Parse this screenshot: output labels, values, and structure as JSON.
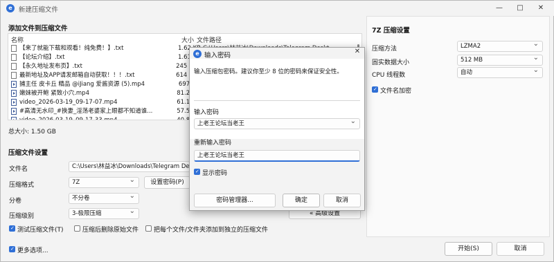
{
  "window": {
    "title": "新建压缩文件",
    "minimize": "—",
    "maximize": "□",
    "close": "✕"
  },
  "files_section": {
    "title": "添加文件到压缩文件",
    "columns": {
      "name": "名称",
      "size": "大小",
      "path": "文件路径"
    },
    "rows": [
      {
        "name": "【来了就能下载和观看！纯免费！】.txt",
        "size": "1.62 KB",
        "path": "C:\\Users\\林益冰\\Downloads\\Telegram Deskt",
        "type": "txt"
      },
      {
        "name": "【论坛介绍】.txt",
        "size": "1.61 KB",
        "path": "",
        "type": "txt"
      },
      {
        "name": "【永久地址发布页】.txt",
        "size": "245 字节",
        "path": "",
        "type": "txt"
      },
      {
        "name": "最新地址及APP请发邮箱自动获取！！！.txt",
        "size": "614 字节",
        "path": "",
        "type": "txt"
      },
      {
        "name": "捕主任 皮卡丘 精品 @iJiang 爱酱资源 (5).mp4",
        "size": "697 MB",
        "path": "",
        "type": "video"
      },
      {
        "name": "嫩妹被开鲍 紧致小穴.mp4",
        "size": "81.2 MB",
        "path": "",
        "type": "video"
      },
      {
        "name": "video_2026-03-19_09-17-07.mp4",
        "size": "61.1 MB",
        "path": "",
        "type": "video"
      },
      {
        "name": "#高清无水印_#换妻_淫荡老婆家上眼都不知道谁...",
        "size": "57.5 MB",
        "path": "",
        "type": "video"
      },
      {
        "name": "video_2026-03-19_09-17-33.mp4",
        "size": "40.8 MB",
        "path": "",
        "type": "video"
      }
    ],
    "total_label": "总大小: 1.50 GB"
  },
  "settings": {
    "title": "压缩文件设置",
    "filename_label": "文件名",
    "filename_value": "C:\\Users\\林益冰\\Downloads\\Telegram Desk",
    "format_label": "压缩格式",
    "format_value": "7Z",
    "set_password_button": "设置密码(P)",
    "split_label": "分卷",
    "split_value": "不分卷",
    "level_label": "压缩级别",
    "level_value": "3-极限压缩",
    "advanced_button": "« 高级设置",
    "test_archive_label": "测试压缩文件(T)",
    "delete_after_label": "压缩后删除原始文件",
    "separate_label": "把每个文件/文件夹添加到独立的压缩文件",
    "more_options_label": "更多选项..."
  },
  "seven_zip": {
    "title": "7Z 压缩设置",
    "method_label": "压缩方法",
    "method_value": "LZMA2",
    "dict_label": "固实数据大小",
    "dict_value": "512 MB",
    "threads_label": "CPU 线程数",
    "threads_value": "自动",
    "encrypt_names_label": "文件名加密"
  },
  "footer": {
    "start_button": "开始(S)",
    "cancel_button": "取消"
  },
  "password_dialog": {
    "title": "输入密码",
    "close": "✕",
    "instruction": "输入压缩包密码。建议你至少 8 位的密码来保证安全性。",
    "password_label": "输入密码",
    "password_value": "上老王论坛当老王",
    "repeat_label": "重新输入密码",
    "repeat_value": "上老王论坛当老王",
    "show_password_label": "显示密码",
    "manager_button": "密码管理器...",
    "ok_button": "确定",
    "cancel_button": "取消"
  },
  "colors": {
    "accent": "#2f6fd6",
    "window_bg": "#f3f3f3"
  }
}
